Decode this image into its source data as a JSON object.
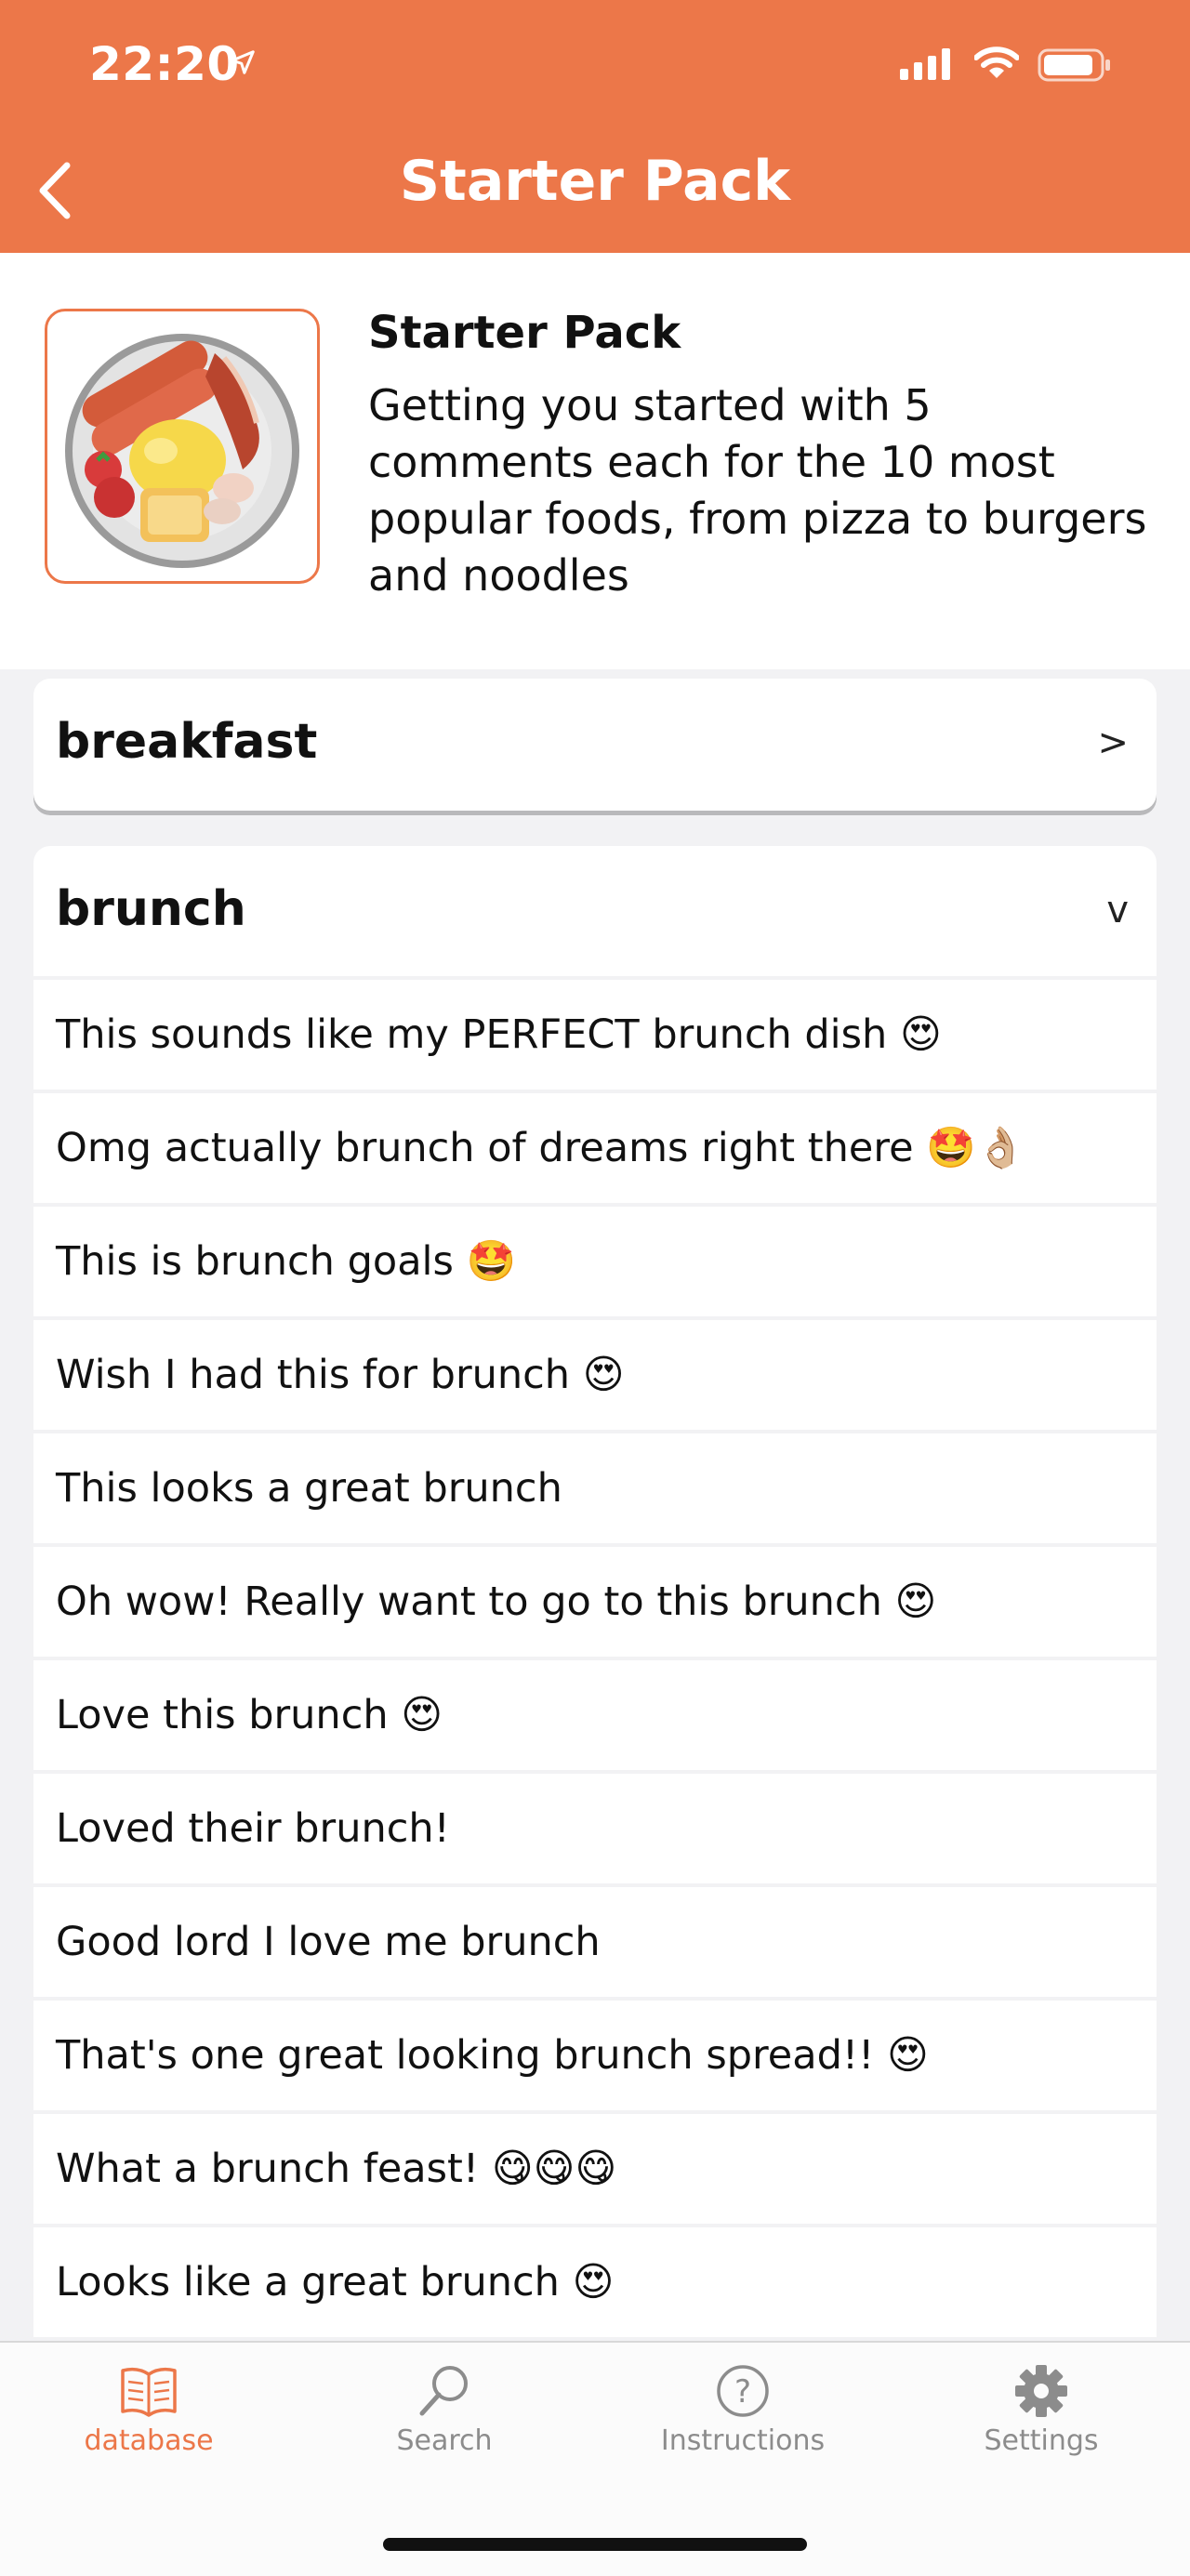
{
  "status_bar": {
    "time": "22:20"
  },
  "nav": {
    "title": "Starter Pack",
    "back_icon": "chevron-left-icon"
  },
  "pack": {
    "title": "Starter Pack",
    "description": "Getting you started with 5 comments each for the 10 most popular foods, from pizza to burgers and noodles",
    "thumbnail": "breakfast-plate-illustration"
  },
  "categories": [
    {
      "label": "breakfast",
      "chevron": ">",
      "expanded": false
    },
    {
      "label": "brunch",
      "chevron": "v",
      "expanded": true
    }
  ],
  "comments": [
    "This sounds like my PERFECT brunch dish 😍",
    "Omg actually brunch of dreams right there 🤩👌🏼",
    "This is brunch goals 🤩",
    "Wish I had this for brunch 😍",
    "This looks a great brunch",
    "Oh wow! Really want to go to this brunch 😍",
    "Love this brunch 😍",
    "Loved their brunch!",
    "Good lord I love me brunch",
    "That's one great looking brunch spread!! 😍",
    "What a brunch feast! 😋😋😋",
    "Looks like a great brunch 😍"
  ],
  "tabs": [
    {
      "label": "database",
      "icon": "book-icon",
      "active": true
    },
    {
      "label": "Search",
      "icon": "search-icon",
      "active": false
    },
    {
      "label": "Instructions",
      "icon": "help-icon",
      "active": false
    },
    {
      "label": "Settings",
      "icon": "gear-icon",
      "active": false
    }
  ],
  "colors": {
    "accent": "#ec7749",
    "background": "#f2f2f4",
    "inactive_tab": "#8c8c8c"
  }
}
